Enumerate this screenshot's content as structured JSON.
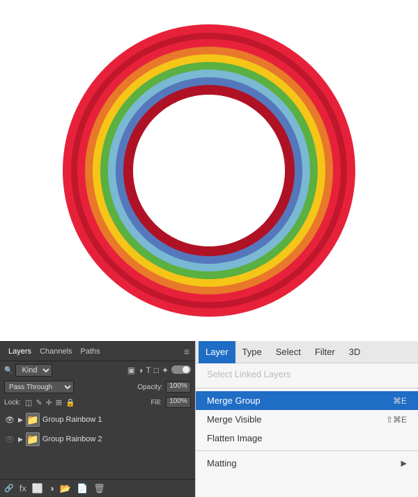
{
  "canvas": {
    "background": "#ffffff",
    "rainbow": {
      "rings": [
        {
          "color": "#e8213a",
          "size": 420
        },
        {
          "color": "#c4172e",
          "size": 390
        },
        {
          "color": "#e8213a",
          "size": 378
        },
        {
          "color": "#e8782a",
          "size": 358
        },
        {
          "color": "#f5c518",
          "size": 336
        },
        {
          "color": "#5ab040",
          "size": 314
        },
        {
          "color": "#7ab8d4",
          "size": 292
        },
        {
          "color": "#5577bc",
          "size": 270
        },
        {
          "color": "#c4172e",
          "size": 248
        },
        {
          "color": "#ffffff",
          "size": 218
        }
      ]
    }
  },
  "layers_panel": {
    "title": "Layers",
    "tabs": [
      "Layers",
      "Channels",
      "Paths"
    ],
    "active_tab": "Layers",
    "filter_label": "Kind",
    "blend_mode": "Pass Through",
    "opacity_label": "Opacity:",
    "opacity_value": "100%",
    "lock_label": "Lock:",
    "fill_label": "Fill:",
    "fill_value": "100%",
    "layers": [
      {
        "name": "Group Rainbow 1",
        "type": "group",
        "visible": true,
        "selected": false,
        "linked": false
      },
      {
        "name": "Group Rainbow 2",
        "type": "group",
        "visible": false,
        "selected": false,
        "linked": true
      }
    ],
    "bottom_bar_icons": [
      "link",
      "fx",
      "layer-style",
      "mask",
      "adjustment",
      "group",
      "new-layer",
      "delete"
    ]
  },
  "menu": {
    "bar_items": [
      "Layer",
      "Type",
      "Select",
      "Filter",
      "3D"
    ],
    "active_item": "Layer",
    "items": [
      {
        "label": "Select Linked Layers",
        "shortcut": "",
        "disabled": true
      },
      {
        "label": "Merge Group",
        "shortcut": "⌘E",
        "highlighted": true
      },
      {
        "label": "Merge Visible",
        "shortcut": "⇧⌘E",
        "highlighted": false
      },
      {
        "label": "Flatten Image",
        "shortcut": "",
        "highlighted": false
      },
      {
        "label": "Matting",
        "shortcut": "▶",
        "highlighted": false,
        "has_arrow": true
      }
    ]
  }
}
